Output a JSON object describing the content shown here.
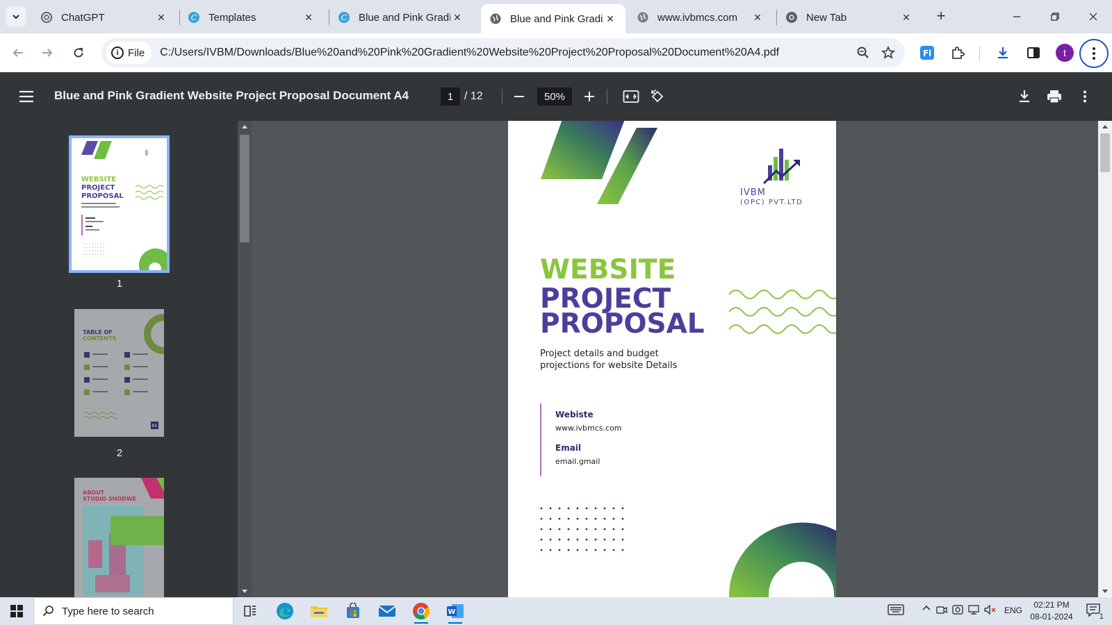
{
  "tabs": [
    {
      "title": "ChatGPT",
      "icon": "chatgpt-icon"
    },
    {
      "title": "Templates",
      "icon": "canva-icon"
    },
    {
      "title": "Blue and Pink Gradie",
      "icon": "canva-icon"
    },
    {
      "title": "Blue and Pink Gradie",
      "icon": "globe-icon",
      "active": true
    },
    {
      "title": "www.ivbmcs.com",
      "icon": "globe-icon"
    },
    {
      "title": "New Tab",
      "icon": "chrome-icon"
    }
  ],
  "address_bar": {
    "chip_label": "File",
    "url": "C:/Users/IVBM/Downloads/Blue%20and%20Pink%20Gradient%20Website%20Project%20Proposal%20Document%20A4.pdf"
  },
  "profile": {
    "initial": "t",
    "color": "#7b1fa2"
  },
  "pdf_viewer": {
    "title": "Blue and Pink Gradient Website Project Proposal Document A4",
    "current_page": "1",
    "total_pages": "/ 12",
    "zoom": "50%"
  },
  "thumbnails": [
    {
      "page": "1",
      "selected": true,
      "heading_line1": "WEBSITE",
      "heading_line2": "PROJECT",
      "heading_line3": "PROPOSAL"
    },
    {
      "page": "2",
      "selected": false,
      "heading_line1": "TABLE OF",
      "heading_line2": "CONTENTS",
      "footer_number": "01"
    },
    {
      "page": "",
      "selected": false,
      "heading_line1": "ABOUT",
      "heading_line2": "STUDIO SHODWE"
    }
  ],
  "document_page": {
    "logo_name": "IVBM",
    "logo_sub": "(OPC) PVT.LTD",
    "title_line1": "WEBSITE",
    "title_line2": "PROJECT",
    "title_line3": "PROPOSAL",
    "subtitle_line1": "Project details and budget",
    "subtitle_line2": "projections for website Details",
    "website_label": "Webiste",
    "website_value": "www.ivbmcs.com",
    "email_label": "Email",
    "email_value": "email.gmail",
    "colors": {
      "green": "#8bc53f",
      "purple": "#4a3f9a",
      "navy": "#2b2d6e"
    }
  },
  "taskbar": {
    "search_placeholder": "Type here to search",
    "language": "ENG",
    "time": "02:21 PM",
    "date": "08-01-2024",
    "notification_count": "1"
  }
}
